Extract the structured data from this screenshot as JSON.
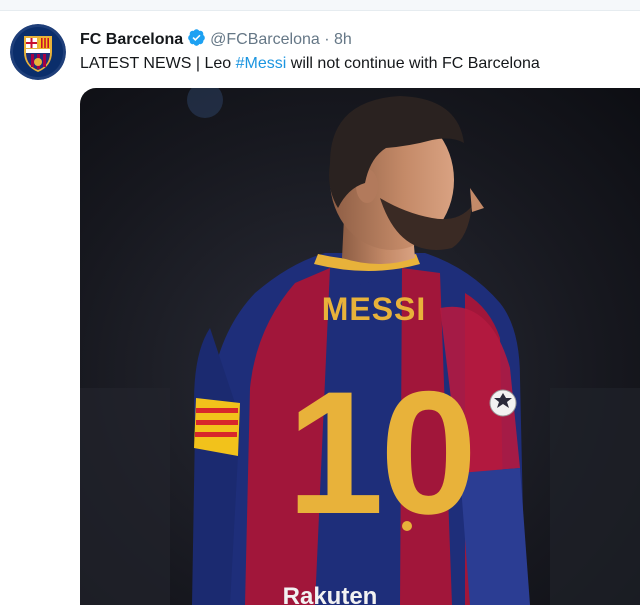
{
  "account": {
    "display_name": "FC Barcelona",
    "handle": "@FCBarcelona",
    "separator": "·",
    "time": "8h",
    "avatar_icon": "fc-barcelona-crest",
    "verified_icon": "verified-badge-icon"
  },
  "tweet": {
    "text_before": "LATEST NEWS | Leo ",
    "hashtag": "#Messi",
    "text_after": " will not continue with FC Barcelona"
  },
  "media": {
    "jersey_name": "MESSI",
    "jersey_number": "10",
    "sponsor_text": "Rakuten",
    "colors": {
      "background": "#141419",
      "blaugrana_red": "#a1163a",
      "blaugrana_blue": "#1e2e7a",
      "gold": "#e8b23a",
      "skin": "#c98f6b",
      "hair": "#2a2220"
    }
  },
  "colors": {
    "text": "#14171a",
    "secondary": "#657786",
    "link": "#1b95e0",
    "verified": "#1da1f2"
  }
}
